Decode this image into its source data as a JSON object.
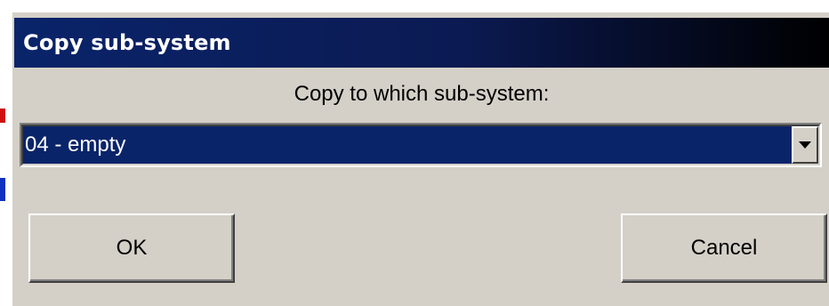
{
  "dialog": {
    "title": "Copy sub-system",
    "prompt": "Copy to which sub-system:",
    "combo": {
      "selected_value": "04 - empty",
      "dropdown_icon": "chevron-down-icon"
    },
    "buttons": {
      "ok_label": "OK",
      "cancel_label": "Cancel"
    }
  },
  "colors": {
    "dialog_face": "#d4d0c8",
    "titlebar_start": "#0a246a",
    "titlebar_end": "#000000",
    "selection": "#0a246a"
  }
}
